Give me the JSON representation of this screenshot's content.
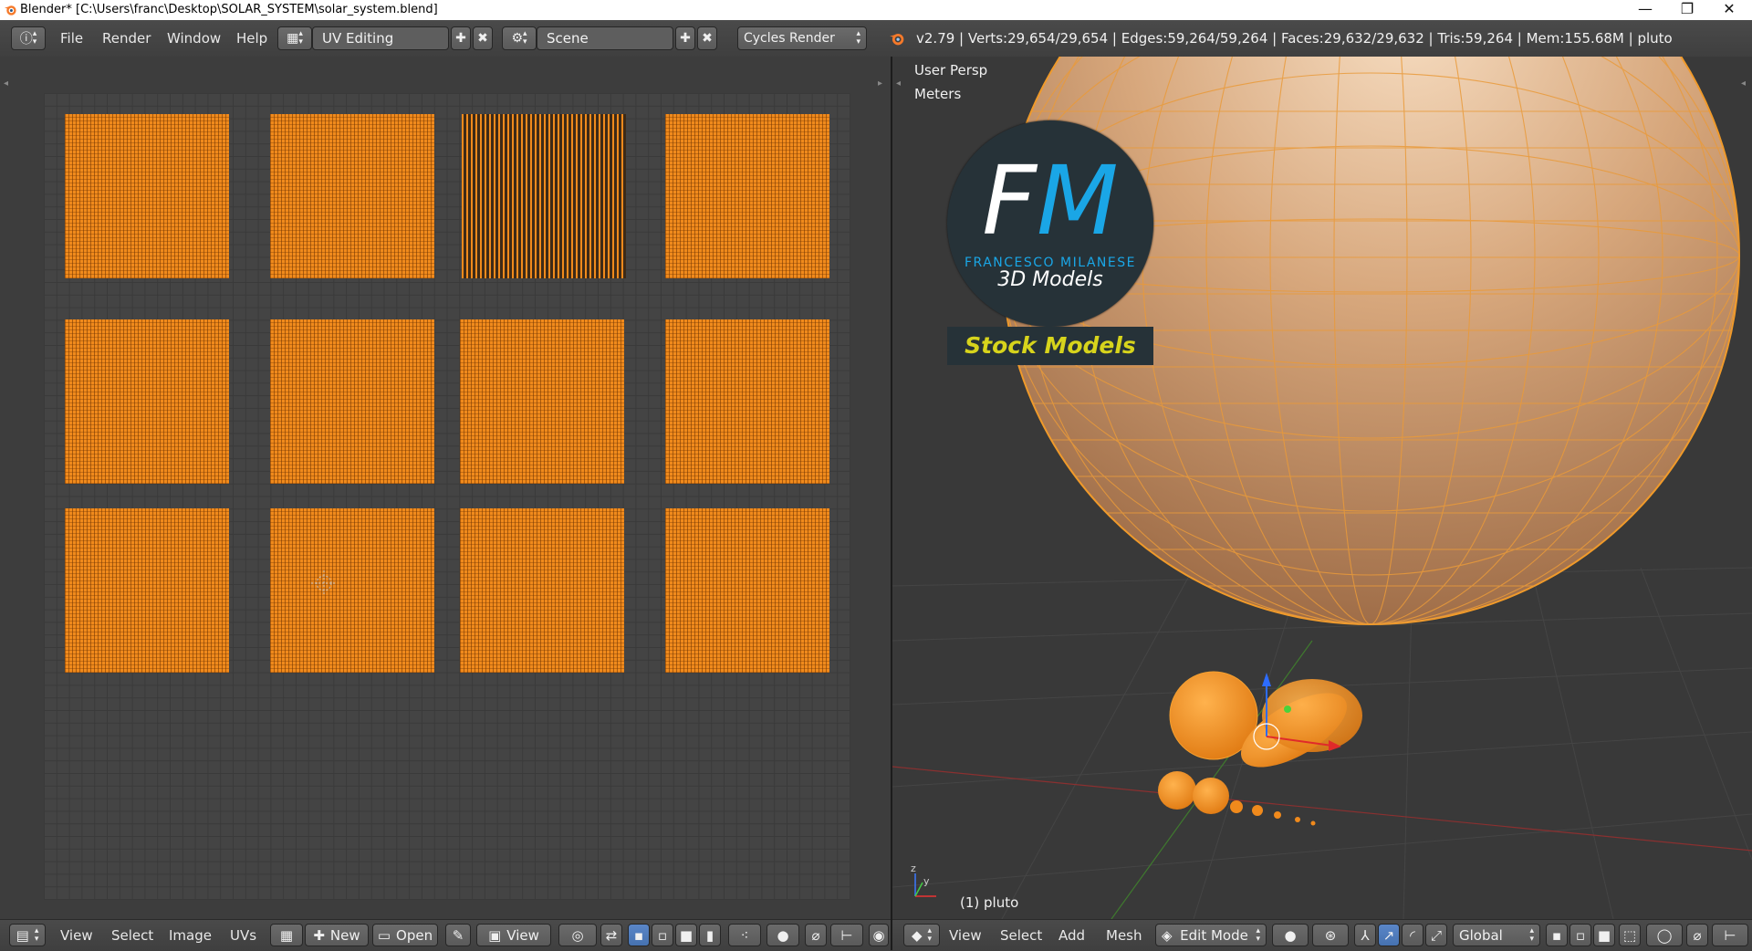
{
  "window": {
    "title": "Blender* [C:\\Users\\franc\\Desktop\\SOLAR_SYSTEM\\solar_system.blend]",
    "minimize": "—",
    "restore": "❐",
    "close": "✕"
  },
  "info_header": {
    "menus": [
      "File",
      "Render",
      "Window",
      "Help"
    ],
    "screen_layout": "UV Editing",
    "scene": "Scene",
    "render_engine": "Cycles Render",
    "stats": "v2.79 | Verts:29,654/29,654 | Edges:59,264/59,264 | Faces:29,632/29,632 | Tris:59,264 | Mem:155.68M | pluto"
  },
  "uv_editor": {
    "islands_rows": 3,
    "islands_cols": 4,
    "header": {
      "menus": [
        "View",
        "Select",
        "Image",
        "UVs"
      ],
      "new_label": "New",
      "open_label": "Open",
      "view_label": "View"
    }
  },
  "viewport": {
    "view_name": "User Persp",
    "units": "Meters",
    "object_label": "(1) pluto",
    "header": {
      "menus": [
        "View",
        "Select",
        "Add",
        "Mesh"
      ],
      "mode": "Edit Mode",
      "orientation": "Global"
    }
  },
  "watermark": {
    "fm_f": "F",
    "fm_m": "M",
    "subtitle": "FRANCESCO MILANESE",
    "tagline": "3D Models",
    "badge": "Stock Models"
  },
  "colors": {
    "uv_selected": "#f08a1c",
    "blender_bg": "#3d3d3d",
    "header_bg": "#4a4a4a",
    "logo_blue": "#1aa6e6",
    "badge_yellow": "#d7d41c",
    "planet_tan": "#e8b98a"
  },
  "icons": {
    "app": "blender-logo-icon",
    "editor_type": "info-icon",
    "add": "plus-icon",
    "remove": "x-icon",
    "render_engine": "blender-render-icon"
  }
}
